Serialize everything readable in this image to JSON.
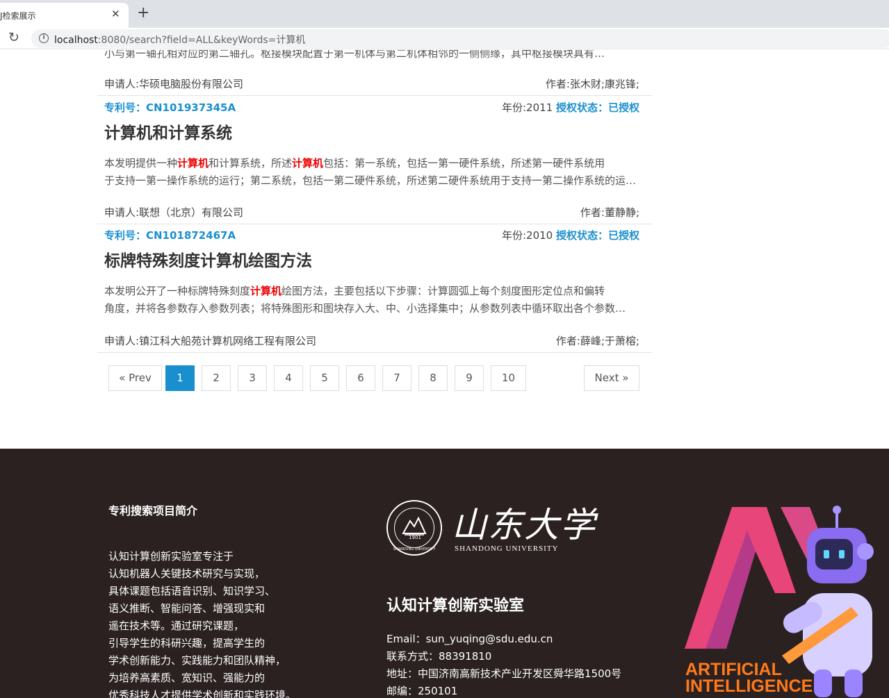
{
  "browser": {
    "tab_title": "J检索展示",
    "url_host": "localhost",
    "url_rest": ":8080/search?field=ALL&keyWords=计算机"
  },
  "results": {
    "cut_line": "小与第一轴孔相对应的第二轴孔。枢接模块配置于第一机体与第二机体相邻的一侧侧缘，其中枢接模块具有…",
    "first_partial": {
      "applicant": "申请人:华硕电脑股份有限公司",
      "authors": "作者:张木财;康兆锋;"
    },
    "items": [
      {
        "patent_no": "专利号：CN101937345A",
        "year": "年份:2011",
        "status": "授权状态：已授权",
        "title": "计算机和计算系统",
        "abstract_line1": [
          {
            "t": "本发明提供一种",
            "hl": false
          },
          {
            "t": "计算机",
            "hl": true
          },
          {
            "t": "和计算系统，所述",
            "hl": false
          },
          {
            "t": "计算机",
            "hl": true
          },
          {
            "t": "包括：第一系统，包括一第一硬件系统，所述第一硬件系统用",
            "hl": false
          }
        ],
        "abstract_line2": "于支持一第一操作系统的运行；第二系统，包括一第二硬件系统，所述第二硬件系统用于支持一第二操作系统的运行…",
        "applicant": "申请人:联想（北京）有限公司",
        "authors": "作者:董静静;"
      },
      {
        "patent_no": "专利号：CN101872467A",
        "year": "年份:2010",
        "status": "授权状态：已授权",
        "title": "标牌特殊刻度计算机绘图方法",
        "abstract_line1": [
          {
            "t": "本发明公开了一种标牌特殊刻度",
            "hl": false
          },
          {
            "t": "计算机",
            "hl": true
          },
          {
            "t": "绘图方法，主要包括以下步骤：计算圆弧上每个刻度图形定位点和偏转",
            "hl": false
          }
        ],
        "abstract_line2": "角度，并将各参数存入参数列表；将特殊图形和图块存入大、中、小选择集中；从参数列表中循环取出各个参数…",
        "applicant": "申请人:镇江科大船苑计算机网络工程有限公司",
        "authors": "作者:薛峰;于萧榕;"
      }
    ]
  },
  "pagination": {
    "prev": "« Prev",
    "pages": [
      "1",
      "2",
      "3",
      "4",
      "5",
      "6",
      "7",
      "8",
      "9",
      "10"
    ],
    "next": "Next »",
    "active": "1"
  },
  "footer": {
    "heading": "专利搜索项目简介",
    "intro": [
      "认知计算创新实验室专注于",
      "认知机器人关键技术研究与实现，",
      "具体课题包括语音识别、知识学习、",
      "语义推断、智能问答、增强现实和",
      "遥在技术等。通过研究课题，",
      "引导学生的科研兴趣，提高学生的",
      "学术创新能力、实践能力和团队精神，",
      "为培养高素质、宽知识、强能力的",
      "优秀科技人才提供学术创新和实践环境。"
    ],
    "university_cn": "山东大学",
    "university_en": "SHANDONG UNIVERSITY",
    "seal_year": "1901",
    "seal_ring": "SHANDONG UNIVERSITY",
    "lab_name": "认知计算创新实验室",
    "contact": [
      "Email：sun_yuqing@sdu.edu.cn",
      "联系方式：88391810",
      "地址：中国济南高新技术产业开发区舜华路1500号",
      "邮编：250101"
    ],
    "ai_line1": "ARTIFICIAL",
    "ai_line2": "INTELLIGENCE",
    "colors": {
      "background": "#2b2121",
      "link_blue": "#1a8fd0",
      "highlight_red": "#ee0000",
      "ai_orange": "#ff7a1a",
      "ai_pink": "#e8457a",
      "robot_purple": "#8a6cf0"
    }
  }
}
